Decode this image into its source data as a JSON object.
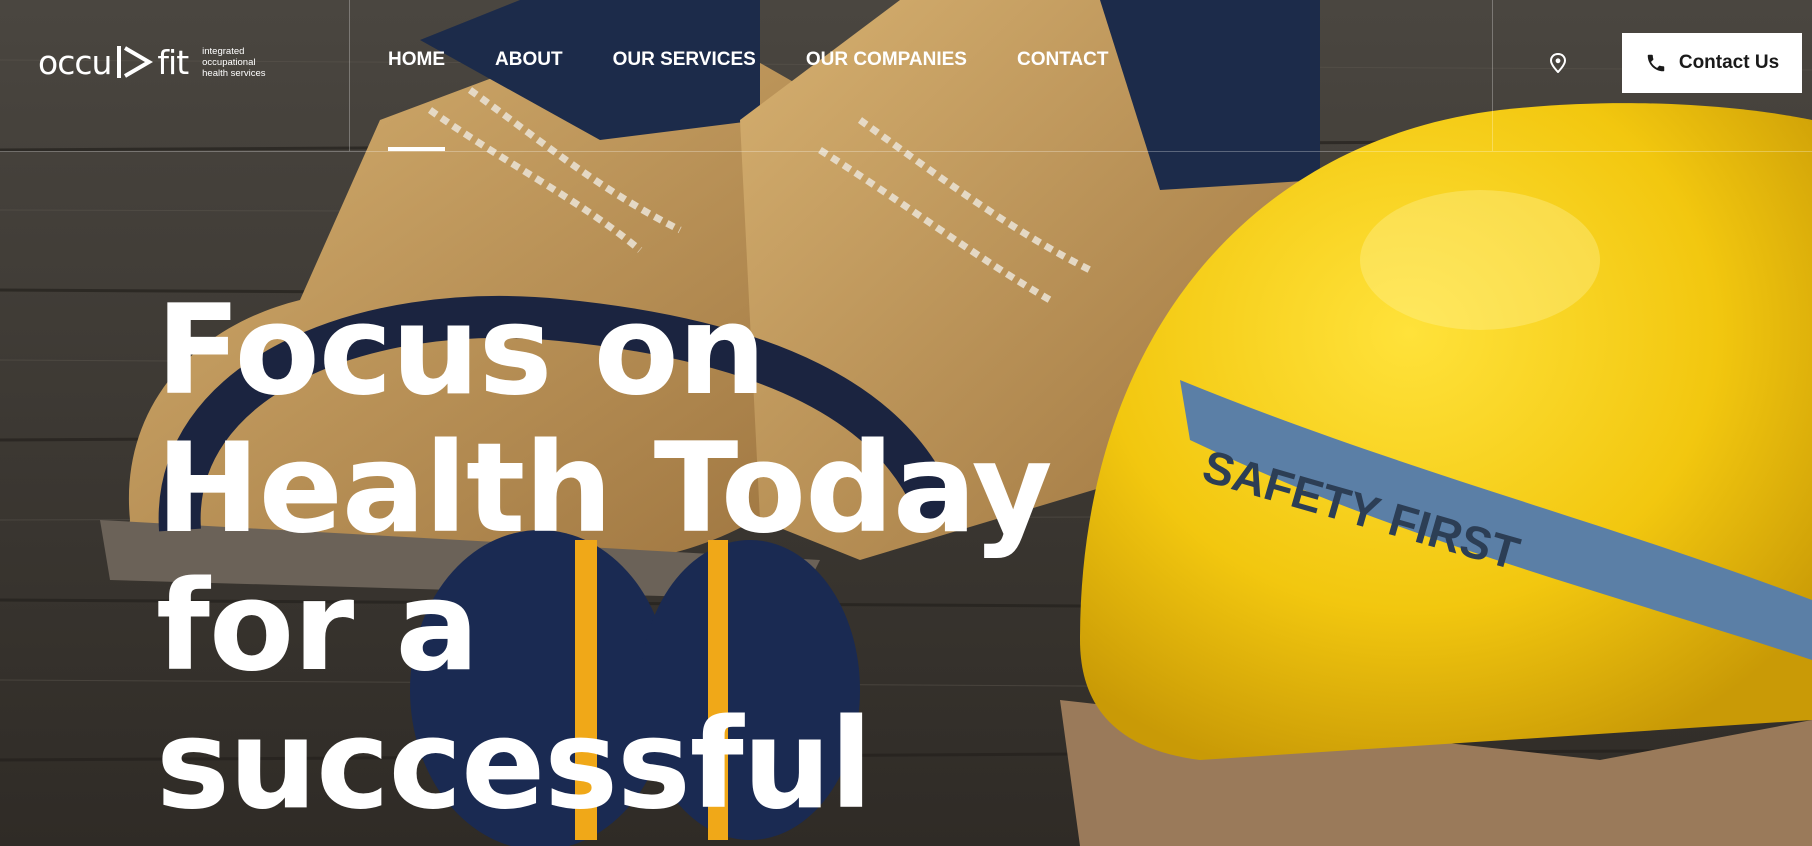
{
  "logo": {
    "word_left": "occu",
    "word_right": "fit",
    "tagline": [
      "integrated",
      "occupational",
      "health services"
    ],
    "icon": "play-triangle-icon"
  },
  "nav": {
    "items": [
      {
        "label": "HOME",
        "active": true
      },
      {
        "label": "ABOUT",
        "active": false
      },
      {
        "label": "OUR SERVICES",
        "active": false
      },
      {
        "label": "OUR COMPANIES",
        "active": false
      },
      {
        "label": "CONTACT",
        "active": false
      }
    ]
  },
  "header": {
    "location_icon": "map-pin-icon",
    "contact_button": {
      "label": "Contact Us",
      "icon": "phone-icon"
    }
  },
  "hero": {
    "headline_lines": [
      "Focus on",
      "Health Today",
      "for a",
      "successful"
    ],
    "background_image": "work boots, ear defenders and yellow hard hat on wooden planks",
    "helmet_strap_text": "SAFETY FIRST"
  },
  "colors": {
    "text": "#ffffff",
    "button_bg": "#ffffff",
    "button_text": "#1a1a1a",
    "helmet": "#f2cc15",
    "boots": "#c8a064",
    "wood": "#3e3a34"
  }
}
